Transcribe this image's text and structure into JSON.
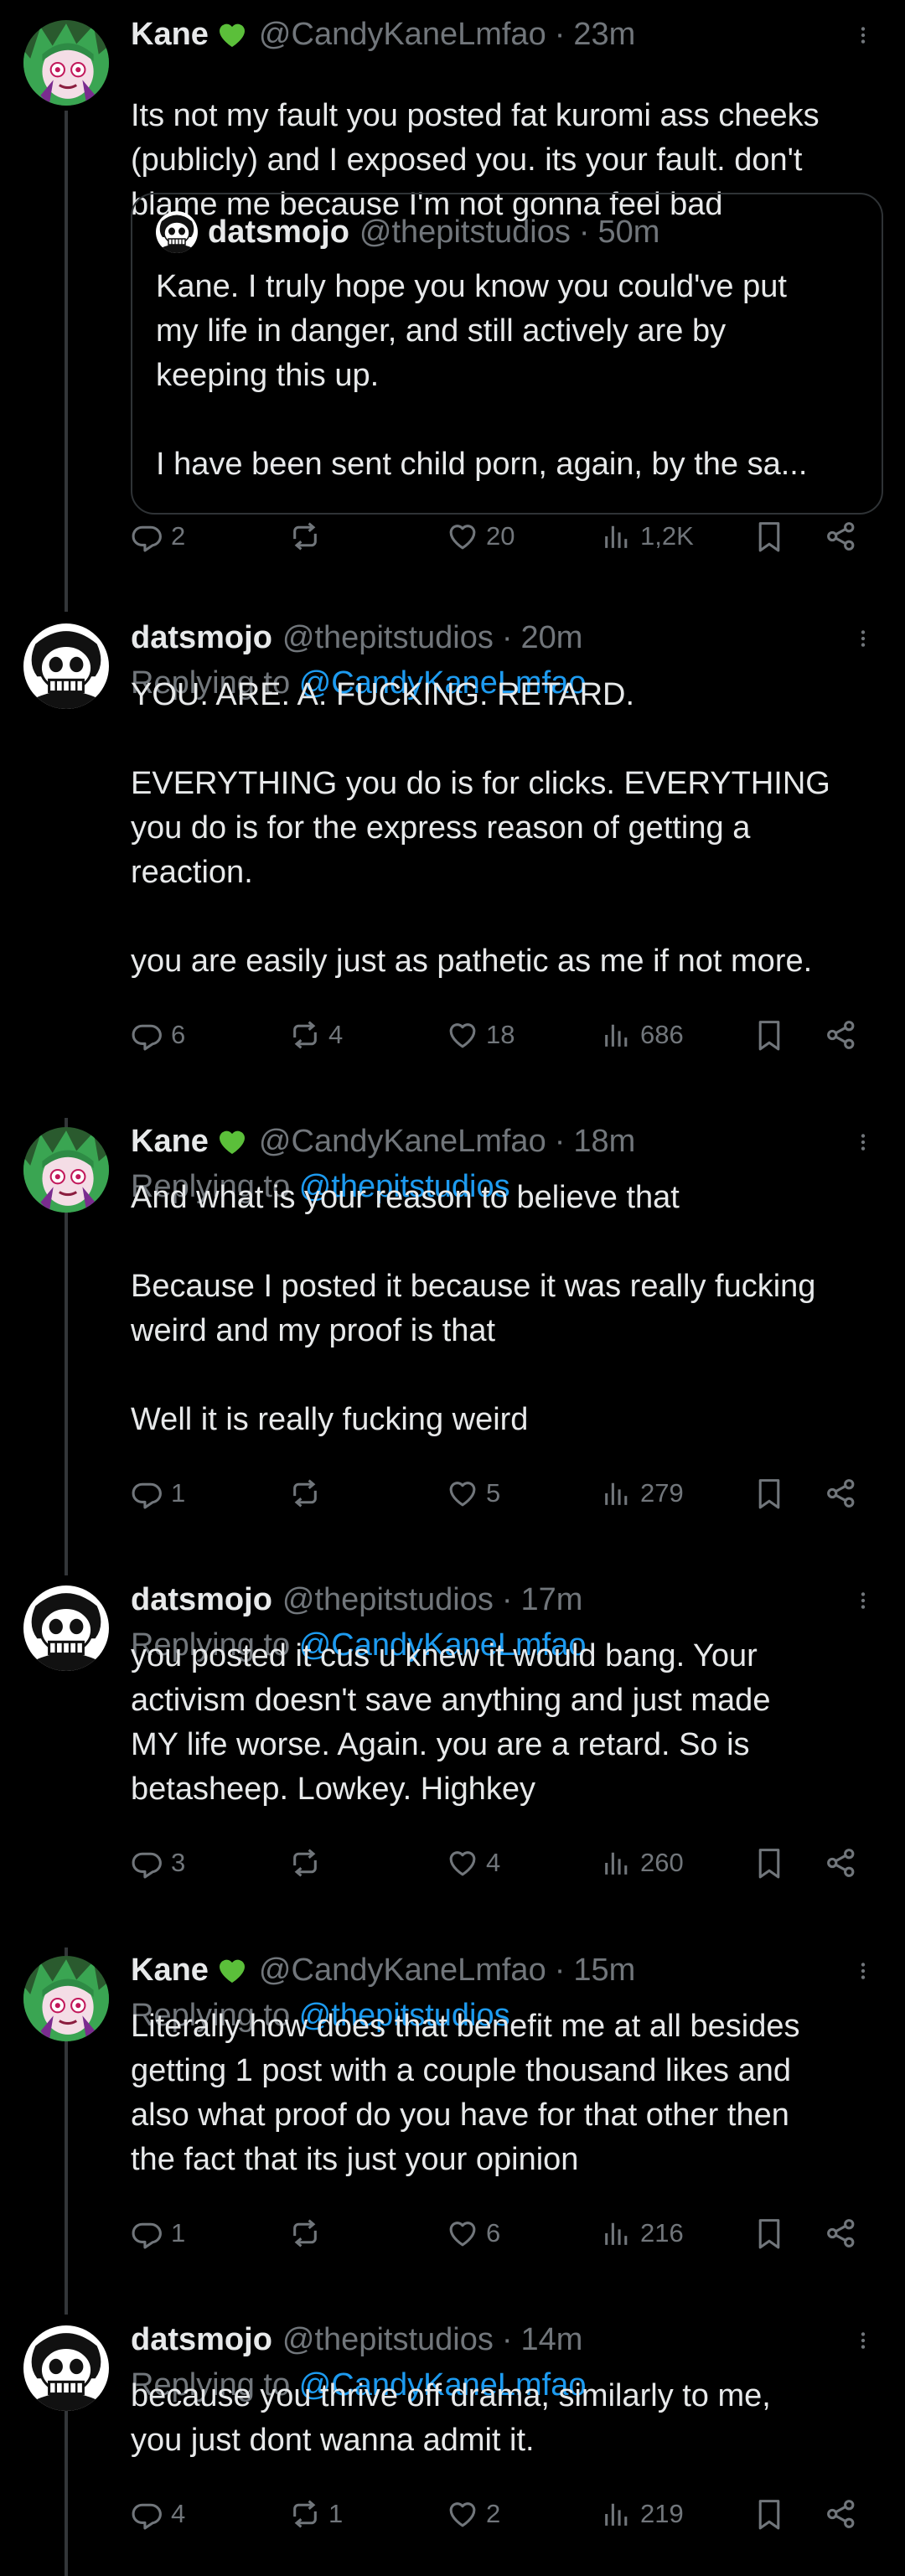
{
  "posts": [
    {
      "author": "Kane",
      "handle": "@CandyKaneLmfao",
      "time": "23m",
      "reply_to": "",
      "lines": [
        "Its not my fault you posted fat kuromi ass cheeks",
        "(publicly) and I exposed you. its your fault. don't",
        "blame me because I'm not gonna feel bad"
      ],
      "quote": {
        "author": "datsmojo",
        "handle": "@thepitstudios",
        "time": "50m",
        "lines": [
          "Kane. I truly hope you know you could've put",
          "my life in danger, and still actively are by",
          "keeping this up.",
          "",
          "I have been sent child porn, again, by the sa..."
        ]
      },
      "replies": "2",
      "reposts": "",
      "likes": "20",
      "views": "1,2K"
    },
    {
      "author": "datsmojo",
      "handle": "@thepitstudios",
      "time": "20m",
      "reply_to": "@CandyKaneLmfao",
      "lines": [
        "YOU. ARE. A. FUCKING. RETARD.",
        "",
        "EVERYTHING you do is for clicks. EVERYTHING",
        "you do is for the express reason of getting a",
        "reaction.",
        "",
        "you are easily just as pathetic as me if not more."
      ],
      "replies": "6",
      "reposts": "4",
      "likes": "18",
      "views": "686"
    },
    {
      "author": "Kane",
      "handle": "@CandyKaneLmfao",
      "time": "18m",
      "reply_to": "@thepitstudios",
      "lines": [
        "And what is your reason to believe that",
        "",
        "Because I posted it because it was really fucking",
        "weird and my proof is that",
        "",
        "Well it is really fucking weird"
      ],
      "replies": "1",
      "reposts": "",
      "likes": "5",
      "views": "279"
    },
    {
      "author": "datsmojo",
      "handle": "@thepitstudios",
      "time": "17m",
      "reply_to": "@CandyKaneLmfao",
      "lines": [
        "you posted it cus u knew it would bang.  Your",
        "activism doesn't save anything and just made",
        "MY life worse. Again. you are a retard. So is",
        "betasheep. Lowkey. Highkey"
      ],
      "replies": "3",
      "reposts": "",
      "likes": "4",
      "views": "260"
    },
    {
      "author": "Kane",
      "handle": "@CandyKaneLmfao",
      "time": "15m",
      "reply_to": "@thepitstudios",
      "lines": [
        "Literally how does that benefit me at all besides",
        "getting 1 post with a couple thousand likes and",
        "also what proof do you have for that other then",
        "the fact that its just your opinion"
      ],
      "replies": "1",
      "reposts": "",
      "likes": "6",
      "views": "216"
    },
    {
      "author": "datsmojo",
      "handle": "@thepitstudios",
      "time": "14m",
      "reply_to": "@CandyKaneLmfao",
      "lines": [
        "because you thrive off drama, similarly to me,",
        "you just dont wanna admit it."
      ],
      "replies": "4",
      "reposts": "1",
      "likes": "2",
      "views": "219"
    }
  ],
  "ui": {
    "replying_label": "Replying to",
    "separator": "·",
    "badge_icon": "green-heart-icon",
    "colors": {
      "background": "#000000",
      "text": "#e7e9ea",
      "muted": "#71767b",
      "link": "#1d9bf0",
      "badge": "#5bbf3a",
      "thread_line": "#333639"
    }
  }
}
